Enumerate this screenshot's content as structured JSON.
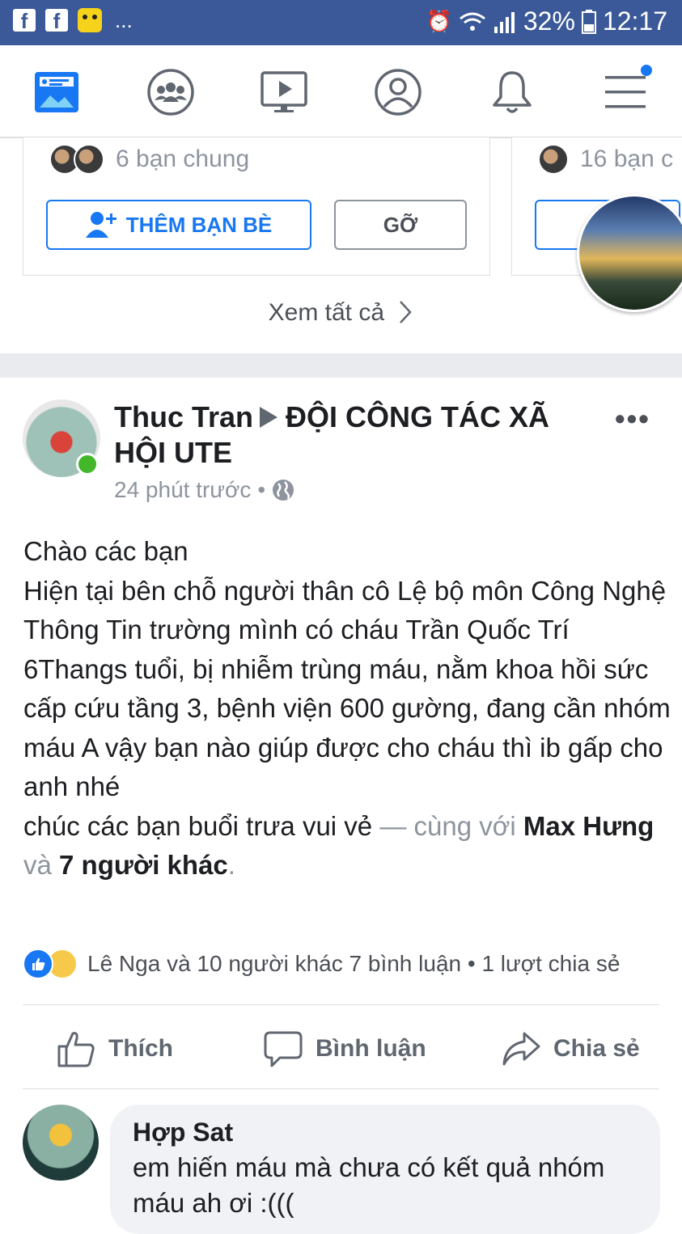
{
  "status_bar": {
    "battery": "32%",
    "time": "12:17",
    "more": "..."
  },
  "suggestion_cards": [
    {
      "mutual_friends": "6 bạn chung",
      "add_button": "THÊM BẠN BÈ",
      "remove_button": "GỠ"
    },
    {
      "mutual_friends": "16 bạn c"
    }
  ],
  "see_all": "Xem tất cả",
  "post": {
    "author": "Thuc Tran",
    "group": "ĐỘI CÔNG TÁC XÃ HỘI UTE",
    "time": "24 phút trước",
    "separator": "•",
    "more": "•••",
    "body_lines": [
      "Chào các bạn",
      "Hiện tại bên chỗ người thân cô Lệ bộ môn Công Nghệ Thông Tin trường mình có cháu Trần Quốc Trí  6Thangs tuổi, bị nhiễm trùng máu, nằm khoa hồi sức cấp cứu tầng 3, bệnh viện 600 gường, đang cần nhóm máu A vậy bạn nào giúp được cho cháu thì ib gấp cho anh nhé",
      "chúc các bạn buổi trưa vui vẻ"
    ],
    "with_prefix": " — cùng với ",
    "tag1": "Max Hưng",
    "and_word": " và ",
    "tag2": "7 người khác",
    "end_punct": ".",
    "reactions_text": "Lê Nga và 10 người khác 7 bình luận • 1 lượt chia sẻ",
    "actions": {
      "like": "Thích",
      "comment": "Bình luận",
      "share": "Chia sẻ"
    }
  },
  "comment": {
    "author": "Hợp Sat",
    "text": "em hiến máu mà chưa có kết quả nhóm máu ah ơi :((("
  }
}
